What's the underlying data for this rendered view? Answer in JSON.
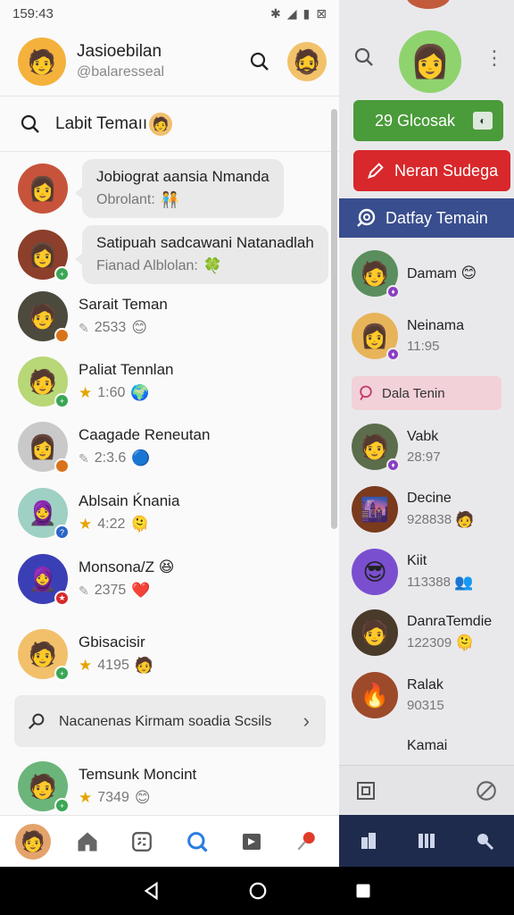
{
  "status": {
    "time": "159:43"
  },
  "header": {
    "name": "Jasioebilan",
    "handle": "@balaresseal"
  },
  "section": {
    "title": "Labit Temaıı"
  },
  "contacts": [
    {
      "name": "Jobiograt aansia Nmanda",
      "sub": "Obrolant:",
      "style": "bubble",
      "avatar_bg": "#c7533b",
      "face": "🙂",
      "emoji": "🧑‍🤝‍🧑"
    },
    {
      "name": "Satipuah sadcawani Natanadlah",
      "sub": "Fianad Alblolan:",
      "style": "bubble",
      "avatar_bg": "#8c3f2a",
      "face": "😊",
      "emoji": "🍀",
      "badge": "#3aa655"
    },
    {
      "name": "Sarait Teman",
      "sub": "2533",
      "prefix": "pen",
      "avatar_bg": "#4b4a3c",
      "face": "😐",
      "emoji": "😊",
      "badge": "#d9731b"
    },
    {
      "name": "Paliat Tennlan",
      "sub": "1:60",
      "prefix": "star",
      "avatar_bg": "#b8d776",
      "face": "😄",
      "emoji": "🌍",
      "badge": "#3aa655"
    },
    {
      "name": "Caagade Reneutan",
      "sub": "2:3.6",
      "prefix": "pen",
      "avatar_bg": "#c9c9c9",
      "face": "🙂",
      "emoji": "🔵",
      "badge": "#d9731b"
    },
    {
      "name": "Ablsain Ḱnania",
      "sub": "4:22",
      "prefix": "star",
      "avatar_bg": "#9fd0c4",
      "face": "🧕",
      "emoji": "🫠",
      "badge": "#2b65c9"
    },
    {
      "name": "Monsona/Z",
      "sub": "2375",
      "prefix": "pen",
      "avatar_bg": "#3b3fb5",
      "face": "🧕",
      "emoji": "❤️",
      "badge": "#d62a2a",
      "name_emoji": "😆"
    },
    {
      "name": "Gbisacisir",
      "sub": "4195",
      "prefix": "star",
      "avatar_bg": "#f2c06a",
      "face": "😀",
      "emoji": "🧑",
      "badge": "#3aa655"
    },
    {
      "name": "Temsunk Moncint",
      "sub": "7349",
      "prefix": "star",
      "avatar_bg": "#6bb57a",
      "face": "😄",
      "emoji": "😊",
      "badge": "#3aa655"
    }
  ],
  "notice": {
    "text": "Nacanenas Kirmam soadia Scsils"
  },
  "right": {
    "green_button": "29 Glcosak",
    "red_button": "Neran Sudega",
    "blue_header": "Datfay Temain",
    "pink_pill": "Dala Tenin",
    "items": [
      {
        "name": "Damam",
        "sub": "",
        "avatar_bg": "#5a8e5e",
        "face": "🙂",
        "emoji": "😊"
      },
      {
        "name": "Neinama",
        "sub": "11:95",
        "avatar_bg": "#e8b45a",
        "face": "🙂"
      },
      {
        "name": "Vabk",
        "sub": "28:97",
        "avatar_bg": "#5b6d4a",
        "face": "😄"
      },
      {
        "name": "Decine",
        "sub": "928838",
        "avatar_bg": "#7a3a1c",
        "face": "🙂",
        "emoji": "🧑"
      },
      {
        "name": "Kiit",
        "sub": "113388",
        "avatar_bg": "#7a4fcf",
        "face": "😎",
        "emoji": "👥"
      },
      {
        "name": "DanraTemdie",
        "sub": "122309",
        "avatar_bg": "#4a3a2a",
        "face": "🙂",
        "emoji": "🫠"
      },
      {
        "name": "Ralak",
        "sub": "90315",
        "avatar_bg": "#9c4a2a",
        "face": "🌅"
      },
      {
        "name": "Kamai",
        "sub": ""
      }
    ]
  },
  "colors": {
    "green": "#4a9b3a",
    "red": "#d8282b",
    "blue": "#394e8e",
    "navy": "#1f2b4c",
    "accent": "#2a7de1"
  }
}
